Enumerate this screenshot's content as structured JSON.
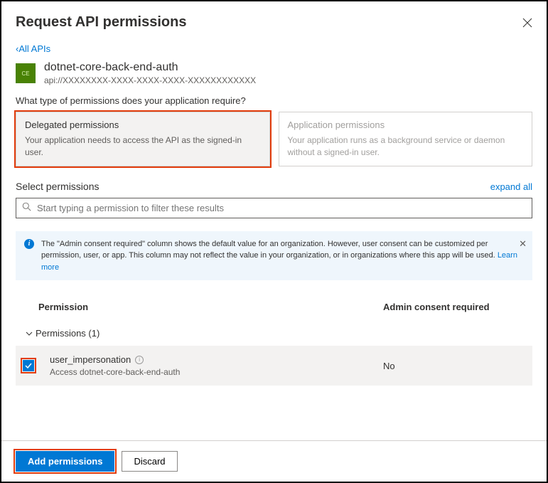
{
  "header": {
    "title": "Request API permissions"
  },
  "backLink": "All APIs",
  "api": {
    "badge": "CE",
    "name": "dotnet-core-back-end-auth",
    "uri": "api://XXXXXXXX-XXXX-XXXX-XXXX-XXXXXXXXXXXX"
  },
  "question": "What type of permissions does your application require?",
  "permCards": {
    "delegated": {
      "title": "Delegated permissions",
      "desc": "Your application needs to access the API as the signed-in user."
    },
    "application": {
      "title": "Application permissions",
      "desc": "Your application runs as a background service or daemon without a signed-in user."
    }
  },
  "selectSection": {
    "title": "Select permissions",
    "expandLabel": "expand all"
  },
  "search": {
    "placeholder": "Start typing a permission to filter these results"
  },
  "infoBanner": {
    "text": "The \"Admin consent required\" column shows the default value for an organization. However, user consent can be customized per permission, user, or app. This column may not reflect the value in your organization, or in organizations where this app will be used. ",
    "linkText": "Learn more"
  },
  "table": {
    "colPermission": "Permission",
    "colConsent": "Admin consent required",
    "groupLabel": "Permissions (1)",
    "item": {
      "name": "user_impersonation",
      "desc": "Access dotnet-core-back-end-auth",
      "consent": "No"
    }
  },
  "footer": {
    "addLabel": "Add permissions",
    "discardLabel": "Discard"
  }
}
